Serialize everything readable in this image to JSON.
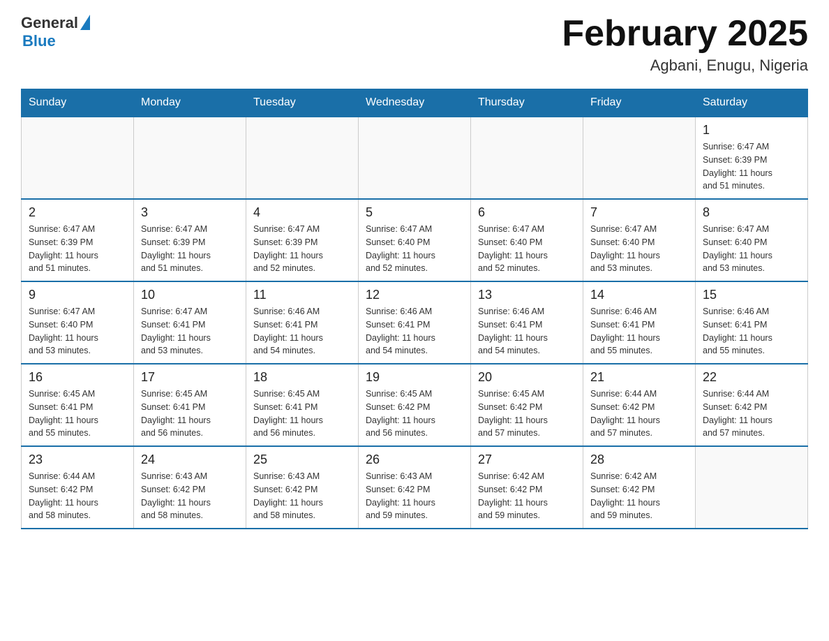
{
  "logo": {
    "general": "General",
    "blue": "Blue"
  },
  "header": {
    "month": "February 2025",
    "location": "Agbani, Enugu, Nigeria"
  },
  "days_of_week": [
    "Sunday",
    "Monday",
    "Tuesday",
    "Wednesday",
    "Thursday",
    "Friday",
    "Saturday"
  ],
  "weeks": [
    [
      {
        "day": "",
        "info": ""
      },
      {
        "day": "",
        "info": ""
      },
      {
        "day": "",
        "info": ""
      },
      {
        "day": "",
        "info": ""
      },
      {
        "day": "",
        "info": ""
      },
      {
        "day": "",
        "info": ""
      },
      {
        "day": "1",
        "info": "Sunrise: 6:47 AM\nSunset: 6:39 PM\nDaylight: 11 hours\nand 51 minutes."
      }
    ],
    [
      {
        "day": "2",
        "info": "Sunrise: 6:47 AM\nSunset: 6:39 PM\nDaylight: 11 hours\nand 51 minutes."
      },
      {
        "day": "3",
        "info": "Sunrise: 6:47 AM\nSunset: 6:39 PM\nDaylight: 11 hours\nand 51 minutes."
      },
      {
        "day": "4",
        "info": "Sunrise: 6:47 AM\nSunset: 6:39 PM\nDaylight: 11 hours\nand 52 minutes."
      },
      {
        "day": "5",
        "info": "Sunrise: 6:47 AM\nSunset: 6:40 PM\nDaylight: 11 hours\nand 52 minutes."
      },
      {
        "day": "6",
        "info": "Sunrise: 6:47 AM\nSunset: 6:40 PM\nDaylight: 11 hours\nand 52 minutes."
      },
      {
        "day": "7",
        "info": "Sunrise: 6:47 AM\nSunset: 6:40 PM\nDaylight: 11 hours\nand 53 minutes."
      },
      {
        "day": "8",
        "info": "Sunrise: 6:47 AM\nSunset: 6:40 PM\nDaylight: 11 hours\nand 53 minutes."
      }
    ],
    [
      {
        "day": "9",
        "info": "Sunrise: 6:47 AM\nSunset: 6:40 PM\nDaylight: 11 hours\nand 53 minutes."
      },
      {
        "day": "10",
        "info": "Sunrise: 6:47 AM\nSunset: 6:41 PM\nDaylight: 11 hours\nand 53 minutes."
      },
      {
        "day": "11",
        "info": "Sunrise: 6:46 AM\nSunset: 6:41 PM\nDaylight: 11 hours\nand 54 minutes."
      },
      {
        "day": "12",
        "info": "Sunrise: 6:46 AM\nSunset: 6:41 PM\nDaylight: 11 hours\nand 54 minutes."
      },
      {
        "day": "13",
        "info": "Sunrise: 6:46 AM\nSunset: 6:41 PM\nDaylight: 11 hours\nand 54 minutes."
      },
      {
        "day": "14",
        "info": "Sunrise: 6:46 AM\nSunset: 6:41 PM\nDaylight: 11 hours\nand 55 minutes."
      },
      {
        "day": "15",
        "info": "Sunrise: 6:46 AM\nSunset: 6:41 PM\nDaylight: 11 hours\nand 55 minutes."
      }
    ],
    [
      {
        "day": "16",
        "info": "Sunrise: 6:45 AM\nSunset: 6:41 PM\nDaylight: 11 hours\nand 55 minutes."
      },
      {
        "day": "17",
        "info": "Sunrise: 6:45 AM\nSunset: 6:41 PM\nDaylight: 11 hours\nand 56 minutes."
      },
      {
        "day": "18",
        "info": "Sunrise: 6:45 AM\nSunset: 6:41 PM\nDaylight: 11 hours\nand 56 minutes."
      },
      {
        "day": "19",
        "info": "Sunrise: 6:45 AM\nSunset: 6:42 PM\nDaylight: 11 hours\nand 56 minutes."
      },
      {
        "day": "20",
        "info": "Sunrise: 6:45 AM\nSunset: 6:42 PM\nDaylight: 11 hours\nand 57 minutes."
      },
      {
        "day": "21",
        "info": "Sunrise: 6:44 AM\nSunset: 6:42 PM\nDaylight: 11 hours\nand 57 minutes."
      },
      {
        "day": "22",
        "info": "Sunrise: 6:44 AM\nSunset: 6:42 PM\nDaylight: 11 hours\nand 57 minutes."
      }
    ],
    [
      {
        "day": "23",
        "info": "Sunrise: 6:44 AM\nSunset: 6:42 PM\nDaylight: 11 hours\nand 58 minutes."
      },
      {
        "day": "24",
        "info": "Sunrise: 6:43 AM\nSunset: 6:42 PM\nDaylight: 11 hours\nand 58 minutes."
      },
      {
        "day": "25",
        "info": "Sunrise: 6:43 AM\nSunset: 6:42 PM\nDaylight: 11 hours\nand 58 minutes."
      },
      {
        "day": "26",
        "info": "Sunrise: 6:43 AM\nSunset: 6:42 PM\nDaylight: 11 hours\nand 59 minutes."
      },
      {
        "day": "27",
        "info": "Sunrise: 6:42 AM\nSunset: 6:42 PM\nDaylight: 11 hours\nand 59 minutes."
      },
      {
        "day": "28",
        "info": "Sunrise: 6:42 AM\nSunset: 6:42 PM\nDaylight: 11 hours\nand 59 minutes."
      },
      {
        "day": "",
        "info": ""
      }
    ]
  ]
}
